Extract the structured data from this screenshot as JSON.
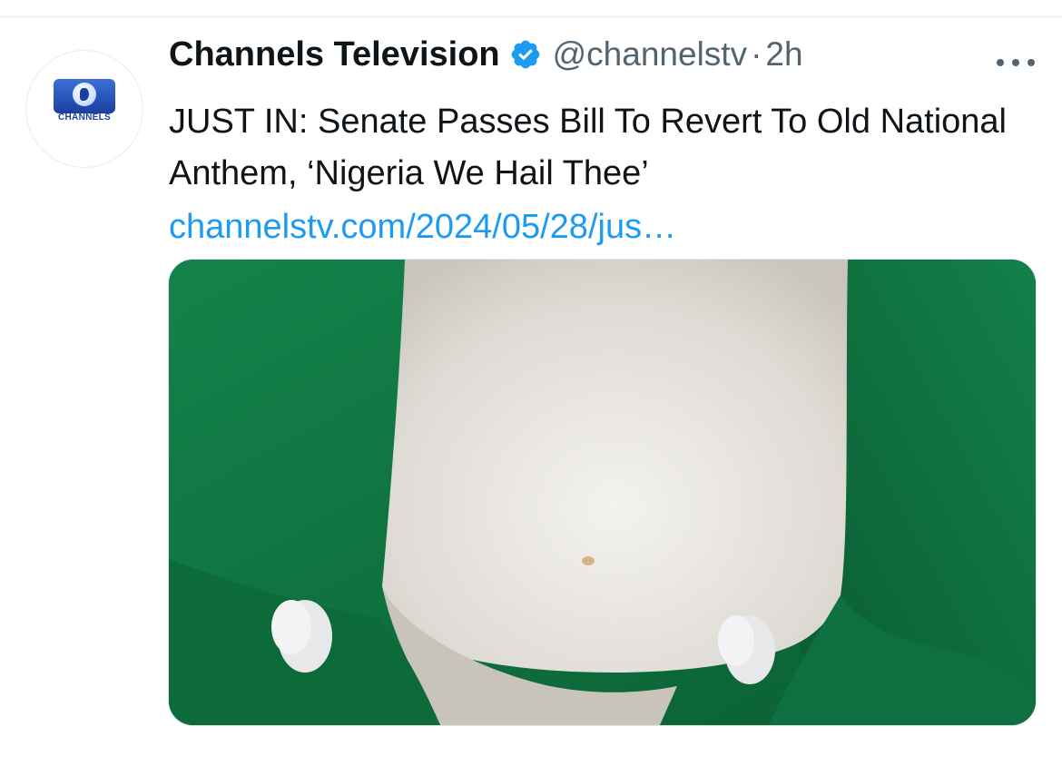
{
  "tweet": {
    "author_name": "Channels Television",
    "handle": "@channelstv",
    "separator": "·",
    "time": "2h",
    "text": "JUST IN: Senate Passes Bill To Revert To Old National Anthem, ‘Nigeria We Hail Thee’",
    "link": "channelstv.com/2024/05/28/jus…",
    "avatar": {
      "logo_text": "CHANNELS",
      "icon": "channels-logo-icon"
    },
    "verified_icon": "verified-badge-icon",
    "more_icon": "more-options-icon",
    "image": {
      "subject": "nigeria-flag-icon",
      "colors": {
        "green": "#0f7a43",
        "white": "#e9e7e2"
      }
    }
  },
  "colors": {
    "text_primary": "#0f1419",
    "text_secondary": "#536471",
    "link": "#1d9bf0",
    "verified": "#1d9bf0"
  }
}
